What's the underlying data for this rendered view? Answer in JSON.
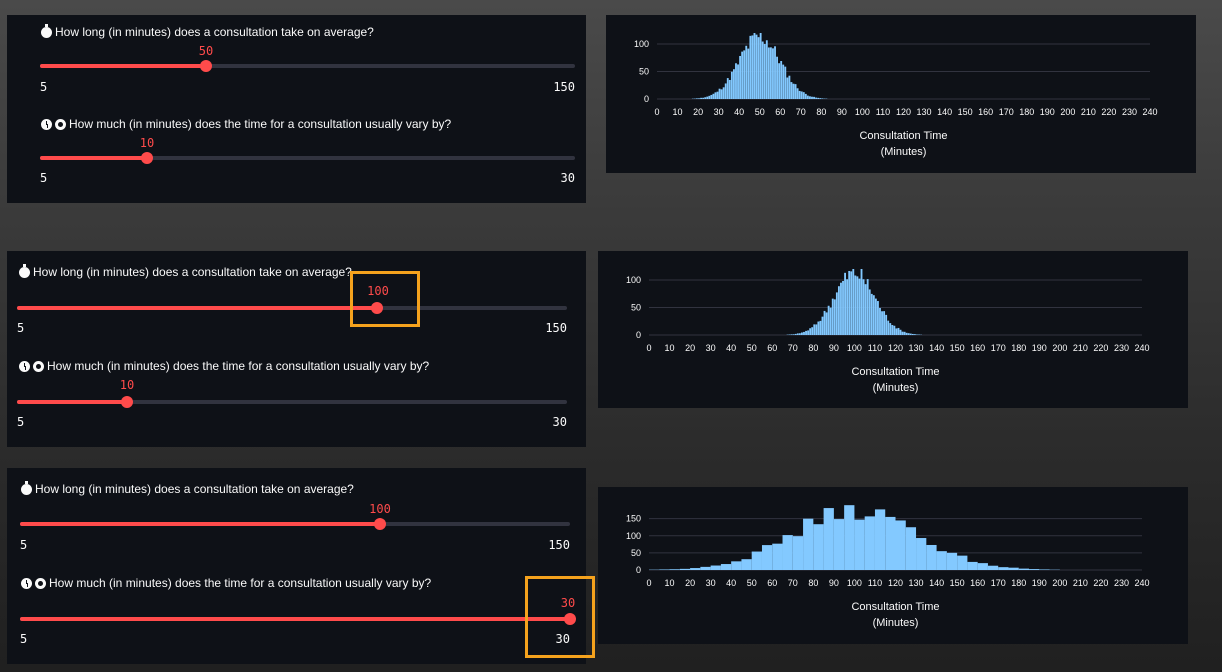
{
  "colors": {
    "accent": "#ff4b4b",
    "panel_bg": "#0e1117",
    "track": "#31333f",
    "bar": "#83c9ff",
    "highlight": "#f5a21d"
  },
  "rows": [
    {
      "sliders": [
        {
          "icon": "stopwatch-icon",
          "label": "How long (in minutes) does a consultation take on average?",
          "value": "50",
          "min": "5",
          "max": "150",
          "fraction": 0.31
        },
        {
          "icon": "clock-icon",
          "label": "How much (in minutes) does the time for a consultation usually vary by?",
          "value": "10",
          "min": "5",
          "max": "30",
          "fraction": 0.2
        }
      ]
    },
    {
      "sliders": [
        {
          "icon": "stopwatch-icon",
          "label": "How long (in minutes) does a consultation take on average?",
          "value": "100",
          "min": "5",
          "max": "150",
          "fraction": 0.655
        },
        {
          "icon": "clock-icon",
          "label": "How much (in minutes) does the time for a consultation usually vary by?",
          "value": "10",
          "min": "5",
          "max": "30",
          "fraction": 0.2
        }
      ]
    },
    {
      "sliders": [
        {
          "icon": "stopwatch-icon",
          "label": "How long (in minutes) does a consultation take on average?",
          "value": "100",
          "min": "5",
          "max": "150",
          "fraction": 0.655
        },
        {
          "icon": "clock-icon",
          "label": "How much (in minutes) does the time for a consultation usually vary by?",
          "value": "30",
          "min": "5",
          "max": "30",
          "fraction": 1.0
        }
      ]
    }
  ],
  "chart_data": [
    {
      "type": "bar",
      "xlabel": "Consultation Time",
      "xlabel_unit": "(Minutes)",
      "xlim": [
        0,
        240
      ],
      "ylim": [
        0,
        120
      ],
      "xticks": [
        "0",
        "10",
        "20",
        "30",
        "40",
        "50",
        "60",
        "70",
        "80",
        "90",
        "100",
        "110",
        "120",
        "130",
        "140",
        "150",
        "160",
        "170",
        "180",
        "190",
        "200",
        "210",
        "220",
        "230",
        "240"
      ],
      "yticks": [
        "0",
        "50",
        "100"
      ],
      "mean": 50,
      "sd": 10,
      "peak": 117
    },
    {
      "type": "bar",
      "xlabel": "Consultation Time",
      "xlabel_unit": "(Minutes)",
      "xlim": [
        0,
        240
      ],
      "ylim": [
        0,
        120
      ],
      "xticks": [
        "0",
        "10",
        "20",
        "30",
        "40",
        "50",
        "60",
        "70",
        "80",
        "90",
        "100",
        "110",
        "120",
        "130",
        "140",
        "150",
        "160",
        "170",
        "180",
        "190",
        "200",
        "210",
        "220",
        "230",
        "240"
      ],
      "yticks": [
        "0",
        "50",
        "100"
      ],
      "mean": 100,
      "sd": 10,
      "peak": 117
    },
    {
      "type": "bar",
      "xlabel": "Consultation Time",
      "xlabel_unit": "(Minutes)",
      "xlim": [
        0,
        240
      ],
      "ylim": [
        0,
        190
      ],
      "xticks": [
        "0",
        "10",
        "20",
        "30",
        "40",
        "50",
        "60",
        "70",
        "80",
        "90",
        "100",
        "110",
        "120",
        "130",
        "140",
        "150",
        "160",
        "170",
        "180",
        "190",
        "200",
        "210",
        "220",
        "230",
        "240"
      ],
      "yticks": [
        "0",
        "50",
        "100",
        "150"
      ],
      "mean": 100,
      "sd": 30,
      "peak": 178
    }
  ]
}
